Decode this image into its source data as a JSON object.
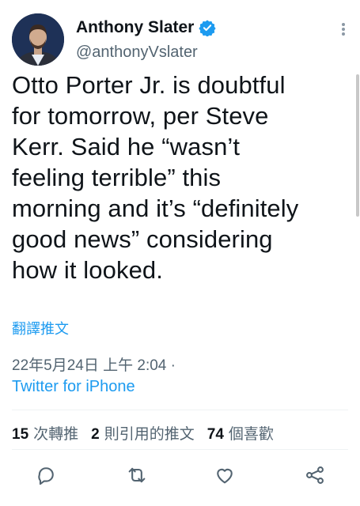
{
  "author": {
    "name": "Anthony Slater",
    "handle": "@anthonyVslater"
  },
  "tweet": {
    "lines": [
      "Otto Porter Jr. is doubtful",
      "for tomorrow, per Steve",
      "Kerr. Said he “wasn’t",
      "feeling terrible” this",
      "morning and it’s “definitely",
      "good news” considering",
      "how it looked."
    ],
    "translate_label": "翻譯推文",
    "timestamp": "22年5月24日 上午 2:04 ·",
    "source": "Twitter for iPhone"
  },
  "stats": {
    "retweets_count": "15",
    "retweets_label": "次轉推",
    "quotes_count": "2",
    "quotes_label": "則引用的推文",
    "likes_count": "74",
    "likes_label": "個喜歡"
  },
  "actions": {
    "icons": [
      "reply-icon",
      "retweet-icon",
      "like-icon",
      "share-icon"
    ]
  },
  "colors": {
    "accent": "#1d9bf0",
    "text": "#0f1419",
    "secondary": "#536471"
  }
}
